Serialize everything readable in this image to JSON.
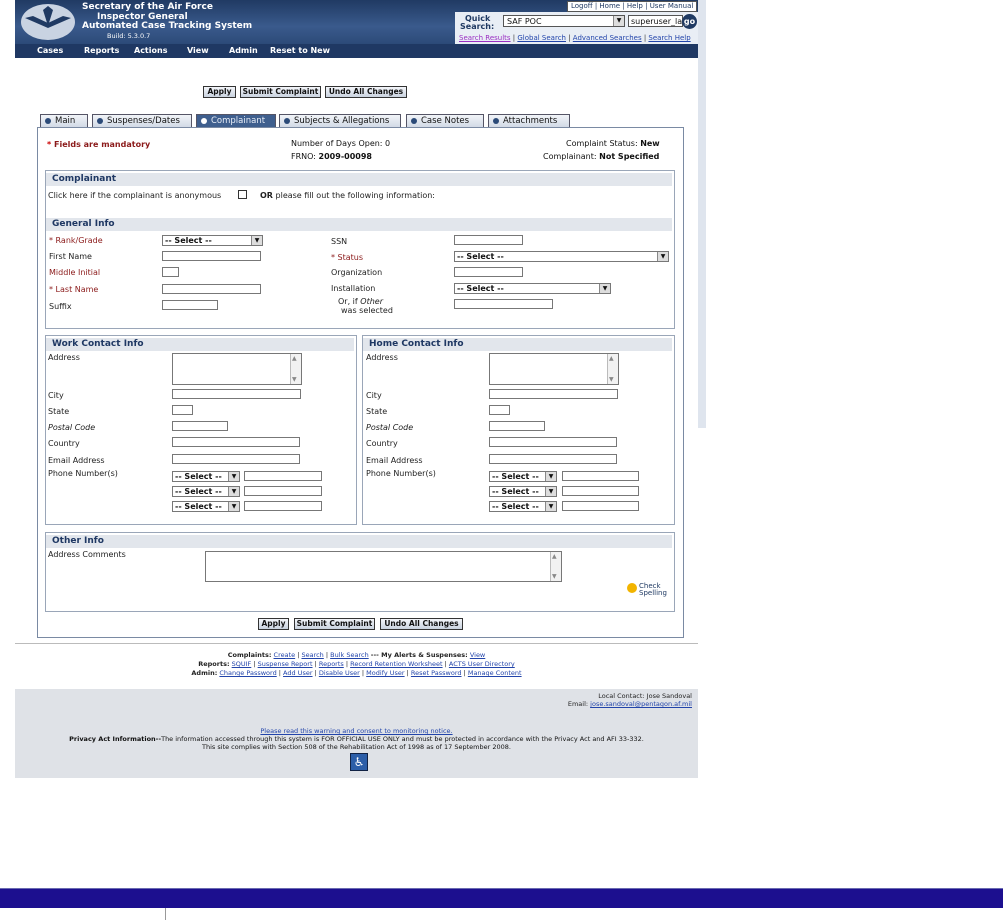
{
  "header": {
    "title_line1": "Secretary of the Air Force",
    "title_line2": "Inspector General",
    "title_line3": "Automated Case Tracking System",
    "build": "Build: 5.3.0.7",
    "top_links": [
      "Logoff",
      "Home",
      "Help",
      "User Manual"
    ]
  },
  "quick_search": {
    "label_line1": "Quick",
    "label_line2": "Search:",
    "selected": "SAF POC",
    "input_value": "superuser_la",
    "go_label": "go",
    "links": [
      "Search Results",
      "Global Search",
      "Advanced Searches",
      "Search Help"
    ]
  },
  "menu": [
    "Cases",
    "Reports",
    "Actions",
    "View",
    "Admin",
    "Reset to New"
  ],
  "actions": {
    "apply": "Apply",
    "submit": "Submit Complaint",
    "undo": "Undo All Changes"
  },
  "tabs": [
    "Main",
    "Suspenses/Dates",
    "Complainant",
    "Subjects & Allegations",
    "Case Notes",
    "Attachments"
  ],
  "status": {
    "mandatory_star": "*",
    "mandatory": "Fields are mandatory",
    "days_open": "Number of Days Open: 0",
    "frno_label": "FRNO:",
    "frno_value": "2009-00098",
    "complaint_status_label": "Complaint Status:",
    "complaint_status_value": "New",
    "complainant_label": "Complainant:",
    "complainant_value": "Not Specified"
  },
  "complainant": {
    "heading": "Complainant",
    "anonymous_text": "Click here if the complainant is anonymous",
    "or_text": "OR",
    "fill_text": "please fill out the following information:"
  },
  "general": {
    "heading": "General Info",
    "rank_grade": "* Rank/Grade",
    "rank_select": "-- Select --",
    "first_name": "First Name",
    "middle_initial": "Middle Initial",
    "last_name": "* Last Name",
    "suffix": "Suffix",
    "ssn": "SSN",
    "status": "* Status",
    "status_select": "-- Select --",
    "organization": "Organization",
    "installation": "Installation",
    "installation_select": "-- Select --",
    "or_if_other_1": "Or, if",
    "or_if_other_em": "Other",
    "or_if_other_2": "was selected"
  },
  "work": {
    "heading": "Work Contact Info",
    "address": "Address",
    "city": "City",
    "state": "State",
    "postal": "Postal Code",
    "country": "Country",
    "email": "Email Address",
    "phone": "Phone Number(s)",
    "phone_select": "-- Select --"
  },
  "home": {
    "heading": "Home Contact Info",
    "address": "Address",
    "city": "City",
    "state": "State",
    "postal": "Postal Code",
    "country": "Country",
    "email": "Email Address",
    "phone": "Phone Number(s)",
    "phone_select": "-- Select --"
  },
  "other": {
    "heading": "Other Info",
    "address_comments": "Address Comments",
    "spell_line1": "Check",
    "spell_line2": "Spelling"
  },
  "footer": {
    "complaints_label": "Complaints:",
    "complaints_create": "Create",
    "complaints_search": "Search",
    "complaints_bulk": "Bulk Search",
    "alerts_label": "--- My Alerts & Suspenses:",
    "alerts_view": "View",
    "reports_label": "Reports:",
    "reports_links": [
      "SQUIF",
      "Suspense Report",
      "Reports",
      "Record Retention Worksheet",
      "ACTS User Directory"
    ],
    "admin_label": "Admin:",
    "admin_links": [
      "Change Password",
      "Add User",
      "Disable User",
      "Modify User",
      "Reset Password",
      "Manage Content"
    ],
    "local_contact": "Local Contact: Jose Sandoval",
    "email_label": "Email:",
    "email_value": "jose.sandoval@pentagon.af.mil",
    "warning_link": "Please read this warning and consent to monitoring notice.",
    "privacy_label": "Privacy Act Information--",
    "privacy_text": "The information accessed through this system is FOR OFFICIAL USE ONLY and must be protected in accordance with the Privacy Act and AFI 33-332.",
    "section508": "This site complies with Section 508 of the Rehabilitation Act of 1998 as of 17 September 2008."
  }
}
